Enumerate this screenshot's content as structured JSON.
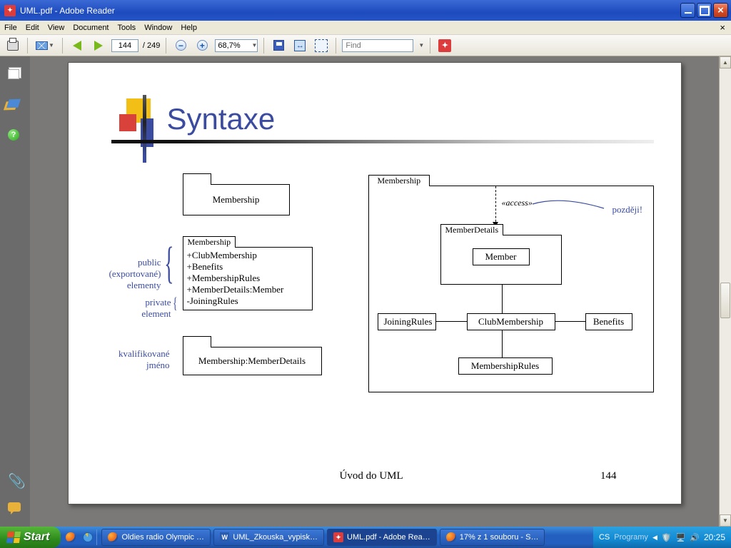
{
  "window": {
    "title": "UML.pdf - Adobe Reader"
  },
  "menu": [
    "File",
    "Edit",
    "View",
    "Document",
    "Tools",
    "Window",
    "Help"
  ],
  "toolbar": {
    "current_page": "144",
    "total_pages": "249",
    "zoom": "68,7%",
    "find_placeholder": "Find"
  },
  "slide": {
    "title": "Syntaxe",
    "footer_center": "Úvod do UML",
    "footer_page": "144",
    "left": {
      "pkg1_name": "Membership",
      "pkg2_tab": "Membership",
      "pkg2_lines": [
        "+ClubMembership",
        "+Benefits",
        "+MembershipRules",
        "+MemberDetails:Member",
        "-JoiningRules"
      ],
      "pkg3_body": "Membership:MemberDetails",
      "label_public": "public\n(exportované)\nelementy",
      "label_private": "private\nelement",
      "label_qualified": "kvalifikované\njméno"
    },
    "right": {
      "pkg_tab": "Membership",
      "access": "«access»",
      "annot": "později!",
      "boxes": {
        "memberdetails": "MemberDetails",
        "member": "Member",
        "joiningrules": "JoiningRules",
        "clubmembership": "ClubMembership",
        "benefits": "Benefits",
        "membershiprules": "MembershipRules"
      }
    }
  },
  "taskbar": {
    "start": "Start",
    "items": [
      "Oldies radio Olympic …",
      "UML_Zkouska_vypisk…",
      "UML.pdf - Adobe Rea…",
      "17% z 1 souboru - S…"
    ],
    "lang": "CS",
    "label_programy": "Programy",
    "clock": "20:25"
  }
}
